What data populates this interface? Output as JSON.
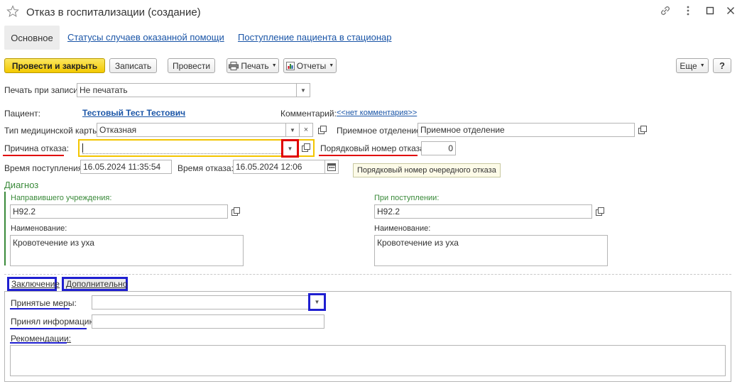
{
  "window": {
    "title": "Отказ в госпитализации (создание)"
  },
  "nav_tabs": [
    {
      "label": "Основное"
    },
    {
      "label": "Статусы случаев оказанной помощи"
    },
    {
      "label": "Поступление пациента в стационар"
    }
  ],
  "toolbar": {
    "post_close": "Провести и закрыть",
    "save": "Записать",
    "post": "Провести",
    "print": "Печать",
    "reports": "Отчеты",
    "more": "Еще",
    "help": "?"
  },
  "print_on_save": {
    "label": "Печать при записи:",
    "value": "Не печатать"
  },
  "patient": {
    "label": "Пациент:",
    "value": "Тестовый Тест Тестович"
  },
  "comment": {
    "label": "Комментарий:",
    "value": "<<нет комментария>>"
  },
  "card_type": {
    "label": "Тип медицинской карты:",
    "value": "Отказная"
  },
  "admission_department": {
    "label": "Приемное отделение:",
    "value": "Приемное отделение"
  },
  "refusal_reason": {
    "label": "Причина отказа:",
    "value": ""
  },
  "refusal_number": {
    "label": "Порядковый номер отказа:",
    "value": "0",
    "tooltip": "Порядковый номер очередного отказа"
  },
  "arrival_time": {
    "label": "Время поступления:",
    "value": "16.05.2024 11:35:54"
  },
  "refusal_time": {
    "label": "Время отказа:",
    "value": "16.05.2024 12:06"
  },
  "diagnosis": {
    "title": "Диагноз",
    "referring": {
      "label": "Направившего учреждения:",
      "code": "H92.2",
      "name_label": "Наименование:",
      "name": "Кровотечение из уха"
    },
    "on_admission": {
      "label": "При поступлении:",
      "code": "H92.2",
      "name_label": "Наименование:",
      "name": "Кровотечение из уха"
    }
  },
  "bottom_tabs": [
    {
      "label": "Заключение"
    },
    {
      "label": "Дополнительно"
    }
  ],
  "conclusion": {
    "measures": {
      "label": "Принятые меры:",
      "value": ""
    },
    "info_received": {
      "label": "Принял информацию:",
      "value": ""
    },
    "recommendations": {
      "label": "Рекомендации:",
      "value": ""
    }
  },
  "colors": {
    "accent_yellow": "#f5d20a",
    "link_blue": "#1a55a7",
    "group_green": "#3a8a3a",
    "mark_red": "#e00000",
    "mark_blue": "#1f1fd0"
  }
}
